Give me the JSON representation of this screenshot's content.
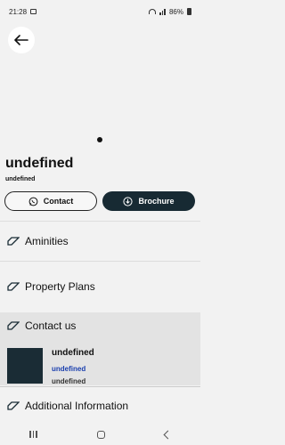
{
  "status": {
    "time": "21:28",
    "battery": "86%"
  },
  "property": {
    "name": "undefined",
    "location": "undefined"
  },
  "actions": {
    "contact_label": "Contact",
    "brochure_label": "Brochure"
  },
  "sections": {
    "amenities": "Aminities",
    "plans": "Property Plans",
    "contact": "Contact us",
    "additional": "Additional Information"
  },
  "agent": {
    "name": "undefined",
    "link": "undefined",
    "extra": "undefined"
  },
  "colors": {
    "primary": "#172a33",
    "link": "#1a3fae",
    "accent": "#1a2c35"
  }
}
